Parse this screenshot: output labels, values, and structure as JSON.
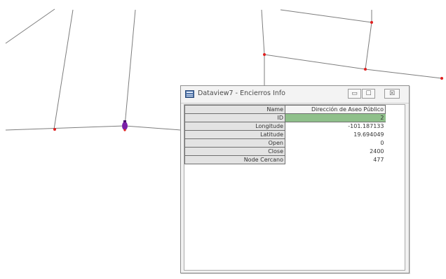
{
  "window": {
    "title": "Dataview7 - Encierros Info",
    "min_glyph": "▭",
    "max_glyph": "☐",
    "close_glyph": "☒"
  },
  "table": {
    "header": {
      "key": "Name",
      "value": "Dirección de Aseo Público"
    },
    "rows": [
      {
        "key": "ID",
        "value": "2"
      },
      {
        "key": "Longitude",
        "value": "-101.187133"
      },
      {
        "key": "Latitude",
        "value": "19.694049"
      },
      {
        "key": "Open",
        "value": "0"
      },
      {
        "key": "Close",
        "value": "2400"
      },
      {
        "key": "Node Cercano",
        "value": "477"
      }
    ]
  },
  "icons": {
    "window": "table-app-icon",
    "marker": "vehicle-marker-icon"
  },
  "colors": {
    "road_line": "#7a7a7a",
    "node_point": "#e02020",
    "marker": "#7a1fa8",
    "selected_row": "#8fc08b"
  }
}
